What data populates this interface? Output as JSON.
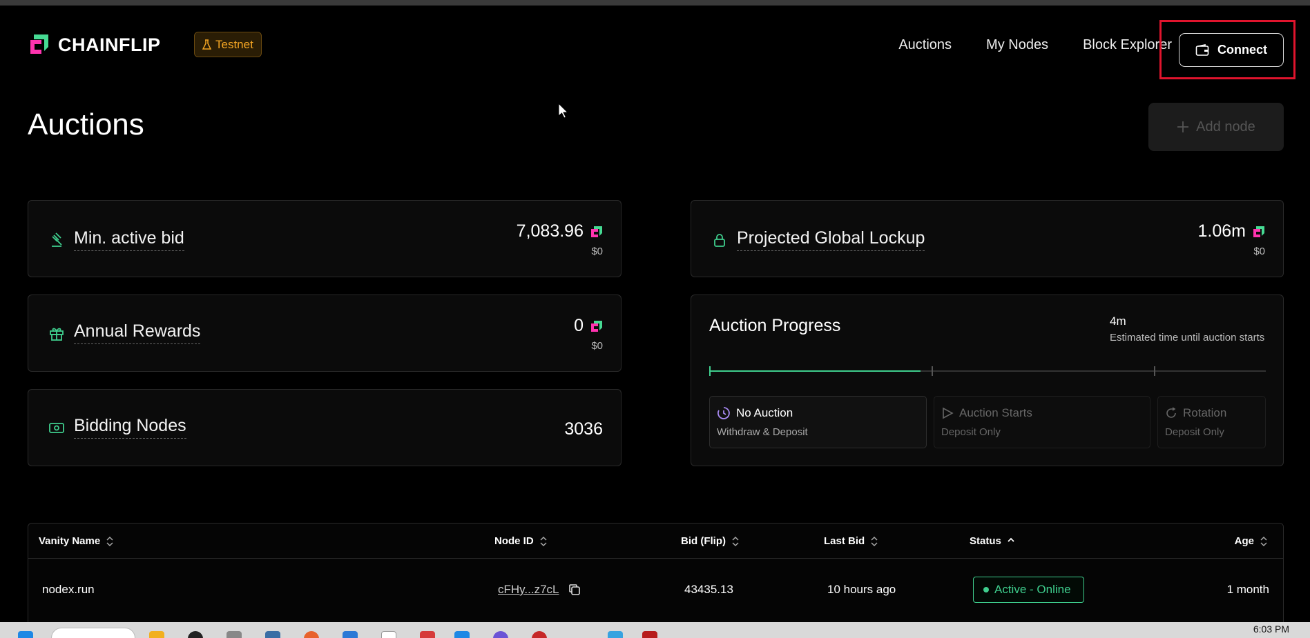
{
  "brand": {
    "name": "CHAINFLIP",
    "badge": "Testnet"
  },
  "nav": {
    "links": [
      "Auctions",
      "My Nodes",
      "Block Explorer"
    ],
    "connect_label": "Connect"
  },
  "page": {
    "title": "Auctions",
    "add_node_label": "Add node"
  },
  "stats": {
    "min_active_bid": {
      "label": "Min. active bid",
      "value": "7,083.96",
      "usd": "$0"
    },
    "annual_rewards": {
      "label": "Annual Rewards",
      "value": "0",
      "usd": "$0"
    },
    "bidding_nodes": {
      "label": "Bidding Nodes",
      "value": "3036"
    },
    "global_lockup": {
      "label": "Projected Global Lockup",
      "value": "1.06m",
      "usd": "$0"
    }
  },
  "auction_progress": {
    "title": "Auction Progress",
    "time_value": "4m",
    "time_label": "Estimated time until auction starts",
    "progress": 0.38,
    "phases": [
      {
        "title": "No Auction",
        "subtitle": "Withdraw & Deposit"
      },
      {
        "title": "Auction Starts",
        "subtitle": "Deposit Only"
      },
      {
        "title": "Rotation",
        "subtitle": "Deposit Only"
      }
    ]
  },
  "table": {
    "columns": [
      "Vanity Name",
      "Node ID",
      "Bid (Flip)",
      "Last Bid",
      "Status",
      "Age"
    ],
    "rows": [
      {
        "vanity_name": "nodex.run",
        "node_id": "cFHy...z7cL",
        "bid": "43435.13",
        "last_bid": "10 hours ago",
        "status": "Active - Online",
        "age": "1 month"
      }
    ]
  },
  "taskbar": {
    "time": "6:03 PM"
  },
  "colors": {
    "accent_green": "#3fcf8e",
    "testnet_orange": "#f5a623",
    "highlight_red": "#e0142d",
    "brand_pink": "#ff33af"
  }
}
